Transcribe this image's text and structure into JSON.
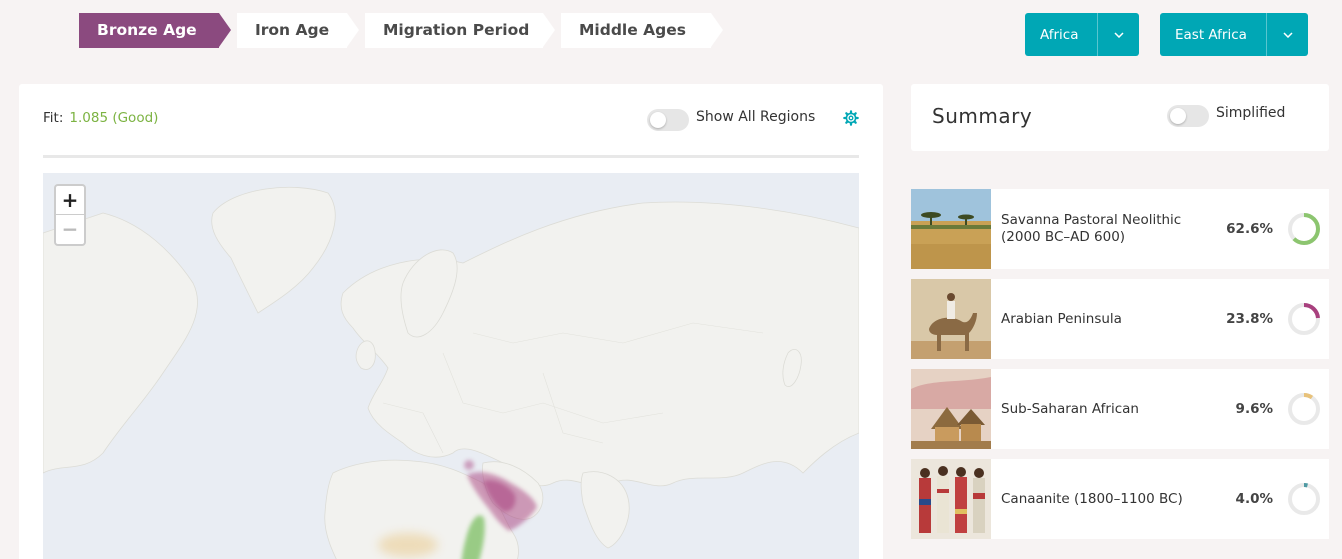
{
  "breadcrumbs": [
    {
      "label": "Bronze Age",
      "active": true
    },
    {
      "label": "Iron Age",
      "active": false
    },
    {
      "label": "Migration Period",
      "active": false
    },
    {
      "label": "Middle Ages",
      "active": false
    }
  ],
  "dropdowns": {
    "continent": {
      "value": "Africa"
    },
    "region": {
      "value": "East Africa"
    }
  },
  "map_panel": {
    "fit_label": "Fit:",
    "fit_value": "1.085 (Good)",
    "show_all_label": "Show All Regions",
    "show_all_on": false,
    "zoom_in": "+",
    "zoom_out": "−"
  },
  "summary": {
    "title": "Summary",
    "simplified_label": "Simplified",
    "simplified_on": false,
    "items": [
      {
        "name": "Savanna Pastoral Neolithic (2000 BC–AD 600)",
        "percent_text": "62.6%",
        "fraction": 0.626,
        "color": "#8cc56f"
      },
      {
        "name": "Arabian Peninsula",
        "percent_text": "23.8%",
        "fraction": 0.238,
        "color": "#a8407e"
      },
      {
        "name": "Sub-Saharan African",
        "percent_text": "9.6%",
        "fraction": 0.096,
        "color": "#e8c27a"
      },
      {
        "name": "Canaanite (1800–1100 BC)",
        "percent_text": "4.0%",
        "fraction": 0.04,
        "color": "#4f9aa3"
      }
    ]
  },
  "colors": {
    "accent": "#00a7b5",
    "active_crumb": "#8b4a7f",
    "fit_good": "#7cb342"
  },
  "icons": {
    "settings": "gear-icon",
    "dropdown": "chevron-down-icon"
  }
}
